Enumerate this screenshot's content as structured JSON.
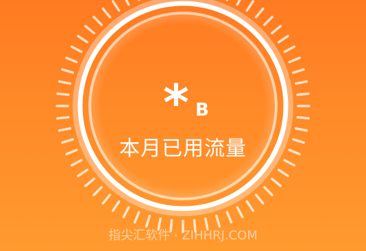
{
  "usage": {
    "value": "*",
    "unit": "B",
    "label": "本月已用流量"
  },
  "watermark": "指尖汇软件 · ZIHHRJ.COM",
  "colors": {
    "background_top": "#ff7b21",
    "background_bottom": "#ff9a2f",
    "ring": "#ffffff",
    "ticks": "#ffffff"
  },
  "icons": {
    "tick_marks": "dial-ticks-icon"
  }
}
